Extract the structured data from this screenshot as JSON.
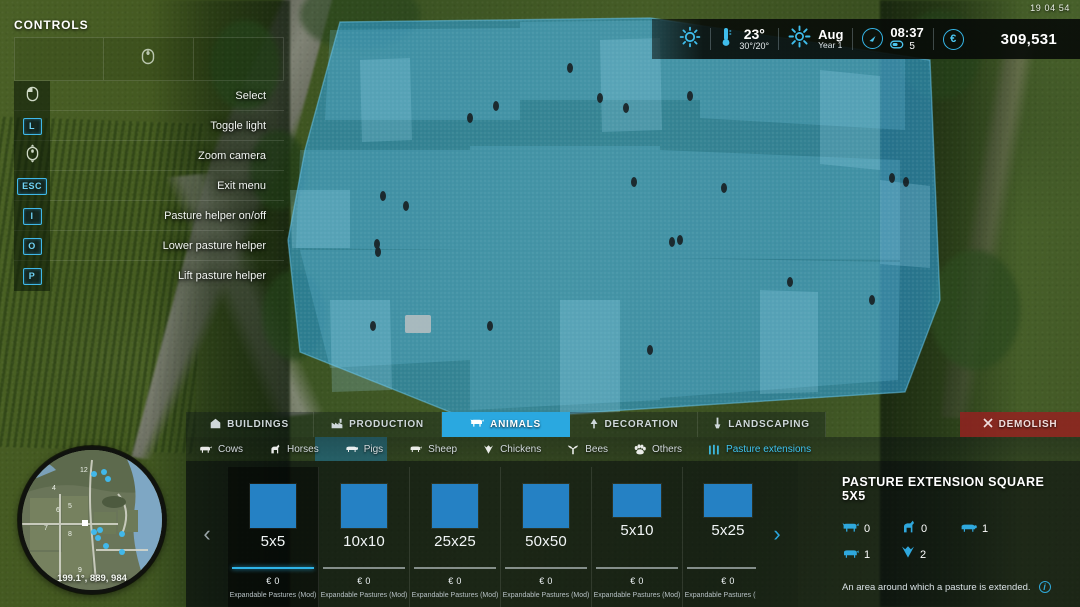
{
  "hud": {
    "timestamp": "19 04 54",
    "weather_icon": "sun-icon",
    "temp_current": "23°",
    "temp_range": "30°/20°",
    "season_icon": "snowflake-sun-icon",
    "month": "Aug",
    "year": "Year 1",
    "clock_icon": "gauge-icon",
    "time": "08:37",
    "fuel_icon": "battery-icon",
    "fuel_value": "5",
    "currency_icon": "euro-icon",
    "money": "309,531",
    "accent": "#35b6e8"
  },
  "controls": {
    "title": "CONTROLS",
    "gamepad_icon": "mouse-icon",
    "items": [
      {
        "key": "",
        "icon": "mouse-left-icon",
        "label": "Select"
      },
      {
        "key": "L",
        "icon": "",
        "label": "Toggle light"
      },
      {
        "key": "",
        "icon": "mouse-scroll-icon",
        "label": "Zoom camera"
      },
      {
        "key": "ESC",
        "icon": "",
        "label": "Exit menu"
      },
      {
        "key": "I",
        "icon": "",
        "label": "Pasture helper on/off"
      },
      {
        "key": "O",
        "icon": "",
        "label": "Lower pasture helper"
      },
      {
        "key": "P",
        "icon": "",
        "label": "Lift pasture helper"
      }
    ]
  },
  "shop": {
    "tabs": [
      {
        "label": "BUILDINGS",
        "icon": "house-icon",
        "active": false
      },
      {
        "label": "PRODUCTION",
        "icon": "factory-icon",
        "active": false
      },
      {
        "label": "ANIMALS",
        "icon": "cow-icon",
        "active": true
      },
      {
        "label": "DECORATION",
        "icon": "tree-icon",
        "active": false
      },
      {
        "label": "LANDSCAPING",
        "icon": "shovel-icon",
        "active": false
      }
    ],
    "demolish": {
      "label": "DEMOLISH",
      "icon": "x-icon",
      "color": "#962020"
    },
    "subtabs": [
      {
        "label": "Cows",
        "icon": "cow-icon",
        "active": false
      },
      {
        "label": "Horses",
        "icon": "horse-icon",
        "active": false
      },
      {
        "label": "Pigs",
        "icon": "pig-icon",
        "active": false
      },
      {
        "label": "Sheep",
        "icon": "sheep-icon",
        "active": false
      },
      {
        "label": "Chickens",
        "icon": "chicken-icon",
        "active": false
      },
      {
        "label": "Bees",
        "icon": "bee-icon",
        "active": false
      },
      {
        "label": "Others",
        "icon": "paw-icon",
        "active": false
      },
      {
        "label": "Pasture extensions",
        "icon": "fence-icon",
        "active": true
      }
    ],
    "prev_icon": "chevron-left-icon",
    "next_icon": "chevron-right-icon",
    "cards": [
      {
        "name": "5x5",
        "price": "€ 0",
        "brand": "Expandable Pastures (Mod)",
        "selected": true,
        "sw": 46,
        "sh": 44
      },
      {
        "name": "10x10",
        "price": "€ 0",
        "brand": "Expandable Pastures (Mod)",
        "selected": false,
        "sw": 46,
        "sh": 44
      },
      {
        "name": "25x25",
        "price": "€ 0",
        "brand": "Expandable Pastures (Mod)",
        "selected": false,
        "sw": 46,
        "sh": 44
      },
      {
        "name": "50x50",
        "price": "€ 0",
        "brand": "Expandable Pastures (Mod)",
        "selected": false,
        "sw": 46,
        "sh": 44
      },
      {
        "name": "5x10",
        "price": "€ 0",
        "brand": "Expandable Pastures (Mod)",
        "selected": false,
        "sw": 48,
        "sh": 33
      },
      {
        "name": "5x25",
        "price": "€ 0",
        "brand": "Expandable Pastures (Mod)",
        "selected": false,
        "sw": 48,
        "sh": 33
      }
    ]
  },
  "detail": {
    "title": "PASTURE EXTENSION SQUARE 5X5",
    "stats": [
      {
        "icon": "cow-icon",
        "value": "0"
      },
      {
        "icon": "horse-icon",
        "value": "0"
      },
      {
        "icon": "pig-icon",
        "value": "1"
      },
      {
        "icon": "sheep-icon",
        "value": "1"
      },
      {
        "icon": "chicken-icon",
        "value": "2"
      }
    ],
    "description": "An area around which a pasture is extended.",
    "info_icon": "info-icon"
  },
  "minimap": {
    "coords": "199.1°, 889, 984",
    "field_labels": [
      "12",
      "4",
      "5",
      "6",
      "7",
      "8",
      "9"
    ]
  },
  "overlay": {
    "fill": "#2f9fd8",
    "stroke": "#63c1ea"
  }
}
